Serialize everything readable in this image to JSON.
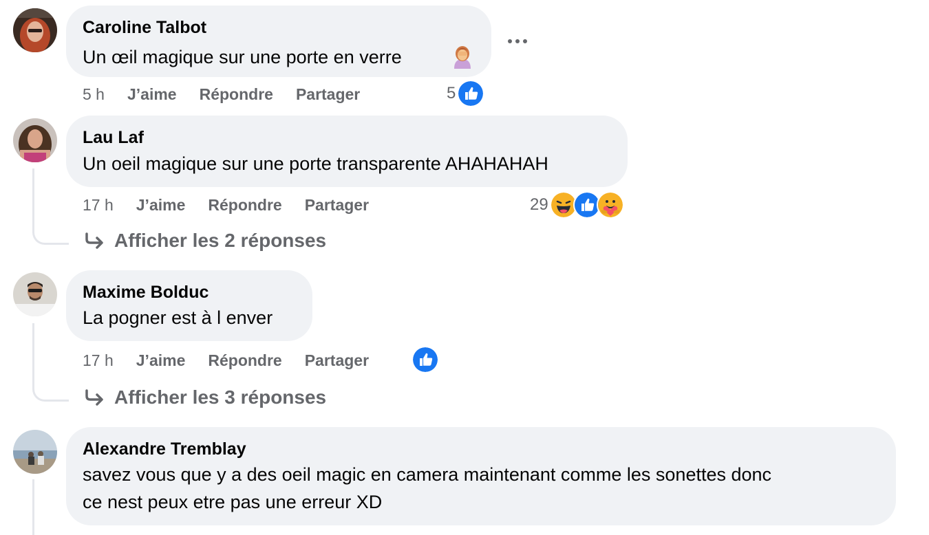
{
  "actions": {
    "like": "J’aime",
    "reply": "Répondre",
    "share": "Partager"
  },
  "colors": {
    "bubble": "#f0f2f5",
    "meta_text": "#65676b",
    "like_blue": "#1877f2",
    "thread_line": "#e4e6eb"
  },
  "comments": [
    {
      "author": "Caroline Talbot",
      "text": "Un œil magique sur une porte en verre",
      "emoji_icon": "woman-facepalming-emoji",
      "time": "5 h",
      "reaction_count": "5",
      "reaction_icons": [
        "like-icon"
      ]
    },
    {
      "author": "Lau Laf",
      "text": "Un oeil magique sur une porte transparente AHAHAHAH",
      "time": "17 h",
      "reaction_count": "29",
      "reaction_icons": [
        "haha-icon",
        "like-icon",
        "care-icon"
      ],
      "replies_label": "Afficher les 2 réponses"
    },
    {
      "author": "Maxime Bolduc",
      "text": "La pogner est à l enver",
      "time": "17 h",
      "reaction_count": "",
      "reaction_icons": [
        "like-icon"
      ],
      "replies_label": "Afficher les 3 réponses"
    },
    {
      "author": "Alexandre Tremblay",
      "text_line1": "savez vous que y a des oeil magic en camera maintenant comme les sonettes donc",
      "text_line2": "ce nest peux etre pas une erreur XD"
    }
  ]
}
